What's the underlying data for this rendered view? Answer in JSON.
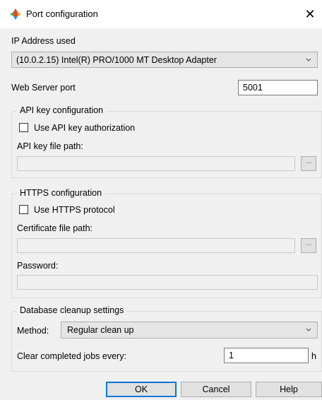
{
  "window": {
    "title": "Port configuration",
    "close_glyph": "✕"
  },
  "ip": {
    "label": "IP Address used",
    "selected": "(10.0.2.15) Intel(R) PRO/1000 MT Desktop Adapter"
  },
  "web_server": {
    "label": "Web Server port",
    "port": "5001"
  },
  "api_key": {
    "legend": "API key configuration",
    "checkbox_label": "Use API key authorization",
    "checked": false,
    "path_label": "API key file path:",
    "path_value": "",
    "browse_label": "..."
  },
  "https": {
    "legend": "HTTPS configuration",
    "checkbox_label": "Use HTTPS protocol",
    "checked": false,
    "cert_label": "Certificate file path:",
    "cert_value": "",
    "browse_label": "...",
    "password_label": "Password:",
    "password_value": ""
  },
  "cleanup": {
    "legend": "Database cleanup settings",
    "method_label": "Method:",
    "method_value": "Regular clean up",
    "clear_label": "Clear completed jobs every:",
    "clear_value": "1",
    "unit": "h"
  },
  "buttons": {
    "ok": "OK",
    "cancel": "Cancel",
    "help": "Help"
  },
  "icons": {
    "app": "app-logo-icon",
    "close": "close-icon",
    "dropdown": "chevron-down-icon"
  }
}
